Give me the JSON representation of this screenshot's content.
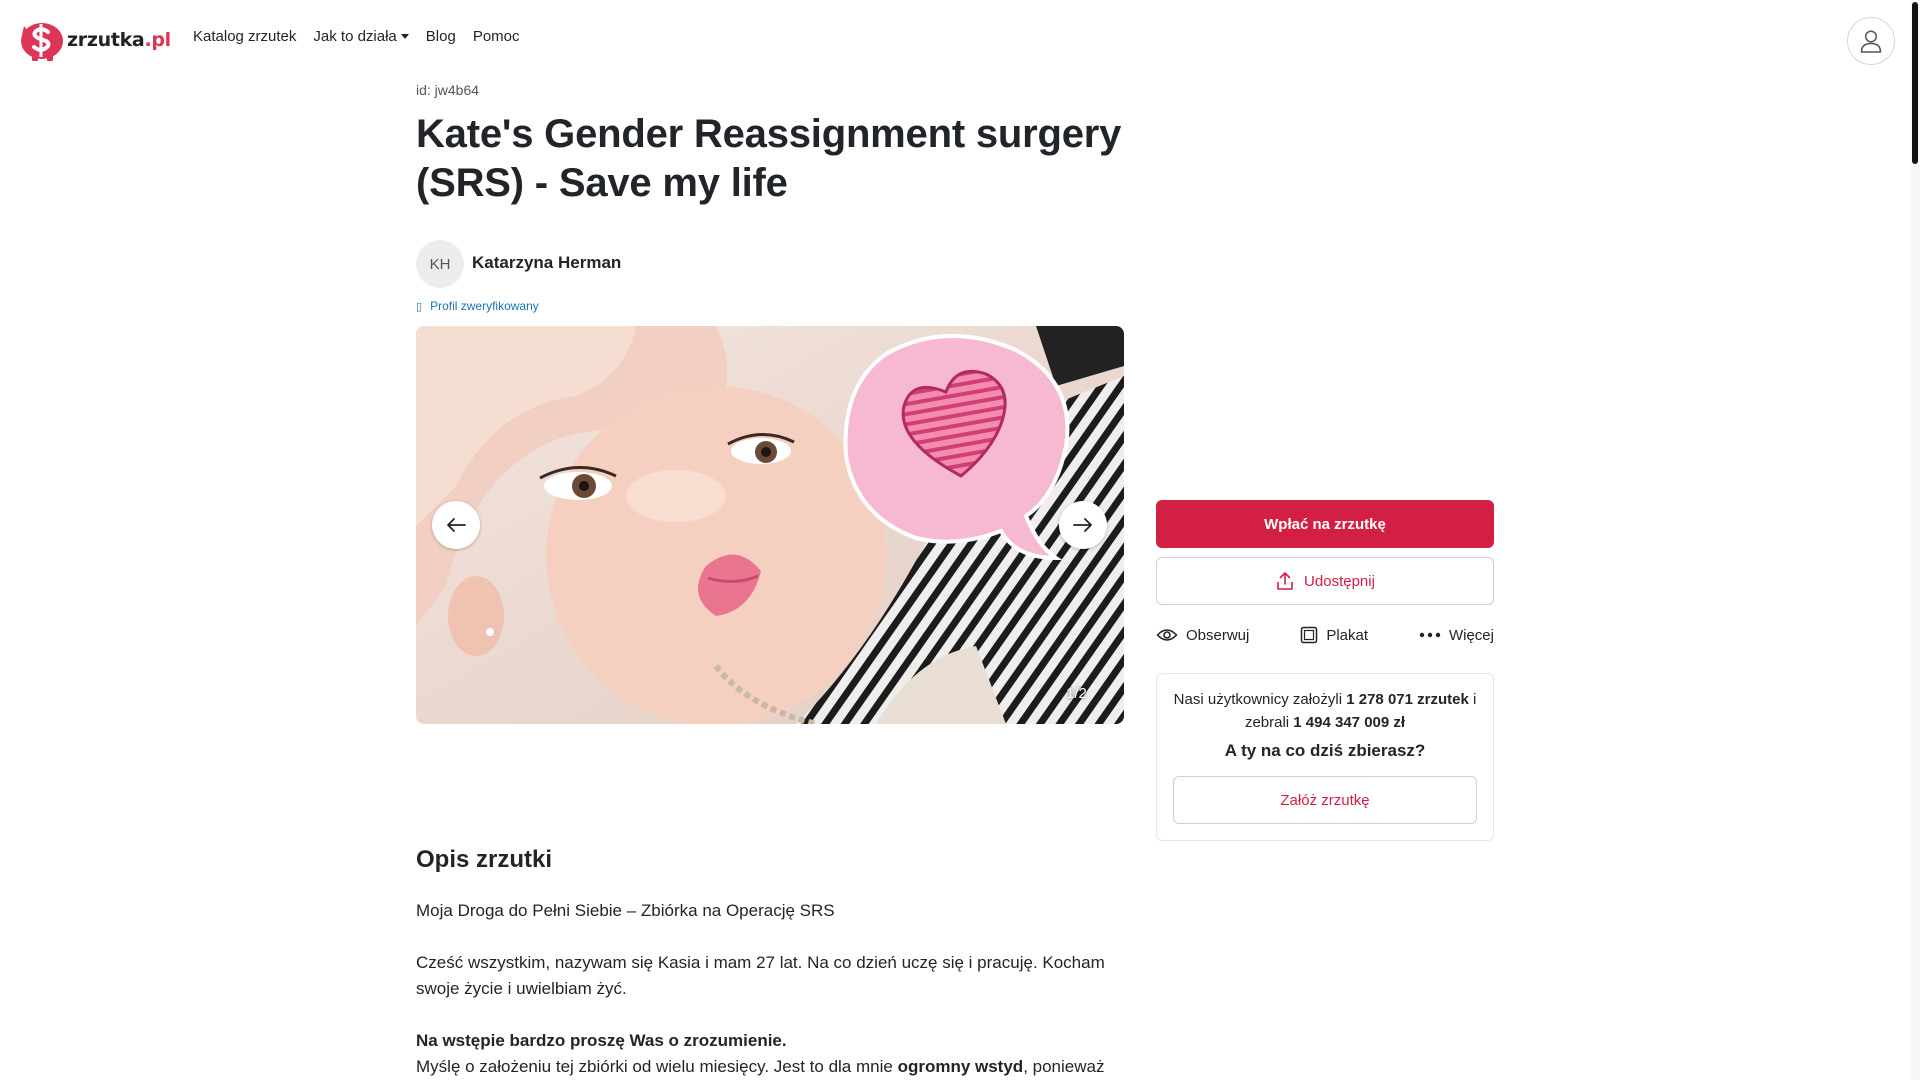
{
  "brand": {
    "name": "zrzutka",
    "tld": ".pl",
    "accent": "#d41f45"
  },
  "nav": {
    "links": [
      "Katalog zrzutek",
      "Jak to działa",
      "Blog",
      "Pomoc"
    ],
    "user_icon": "user-icon"
  },
  "fundraiser": {
    "id_text": "id: jw4b64",
    "title": "Kate's Gender Reassignment surgery (SRS) - Save my life",
    "author": {
      "initials": "KH",
      "name": "Katarzyna Herman",
      "verified_label": "Profil zweryfikowany"
    },
    "gallery": {
      "counter": "1/2",
      "prev_icon": "arrow-left-icon",
      "next_icon": "arrow-right-icon"
    }
  },
  "sidebar": {
    "pay_label": "Wpłać na zrzutkę",
    "share_label": "Udostępnij",
    "actions": {
      "follow": "Obserwuj",
      "poster": "Plakat",
      "more": "Więcej"
    },
    "stats": {
      "prefix": "Nasi użytkownicy założyli",
      "fundraisers_count": "1 278 071 zrzutek",
      "middle": "i zebrali",
      "amount": "1 494 347 009 zł",
      "question": "A ty na co dziś zbierasz?",
      "create_label": "Załóż zrzutkę"
    }
  },
  "description": {
    "heading": "Opis zrzutki",
    "p1": "Moja Droga do Pełni Siebie – Zbiórka na Operację SRS",
    "p2": "Cześć wszystkim, nazywam się Kasia i mam 27 lat. Na co dzień uczę się i pracuję. Kocham swoje życie i uwielbiam żyć.",
    "p3_bold": "Na wstępie bardzo proszę Was o zrozumienie.",
    "p4_start": "Myślę o założeniu tej zbiórki od wielu miesięcy. Jest to dla mnie ",
    "p4_bold": "ogromny wstyd",
    "p4_end": ", ponieważ"
  }
}
